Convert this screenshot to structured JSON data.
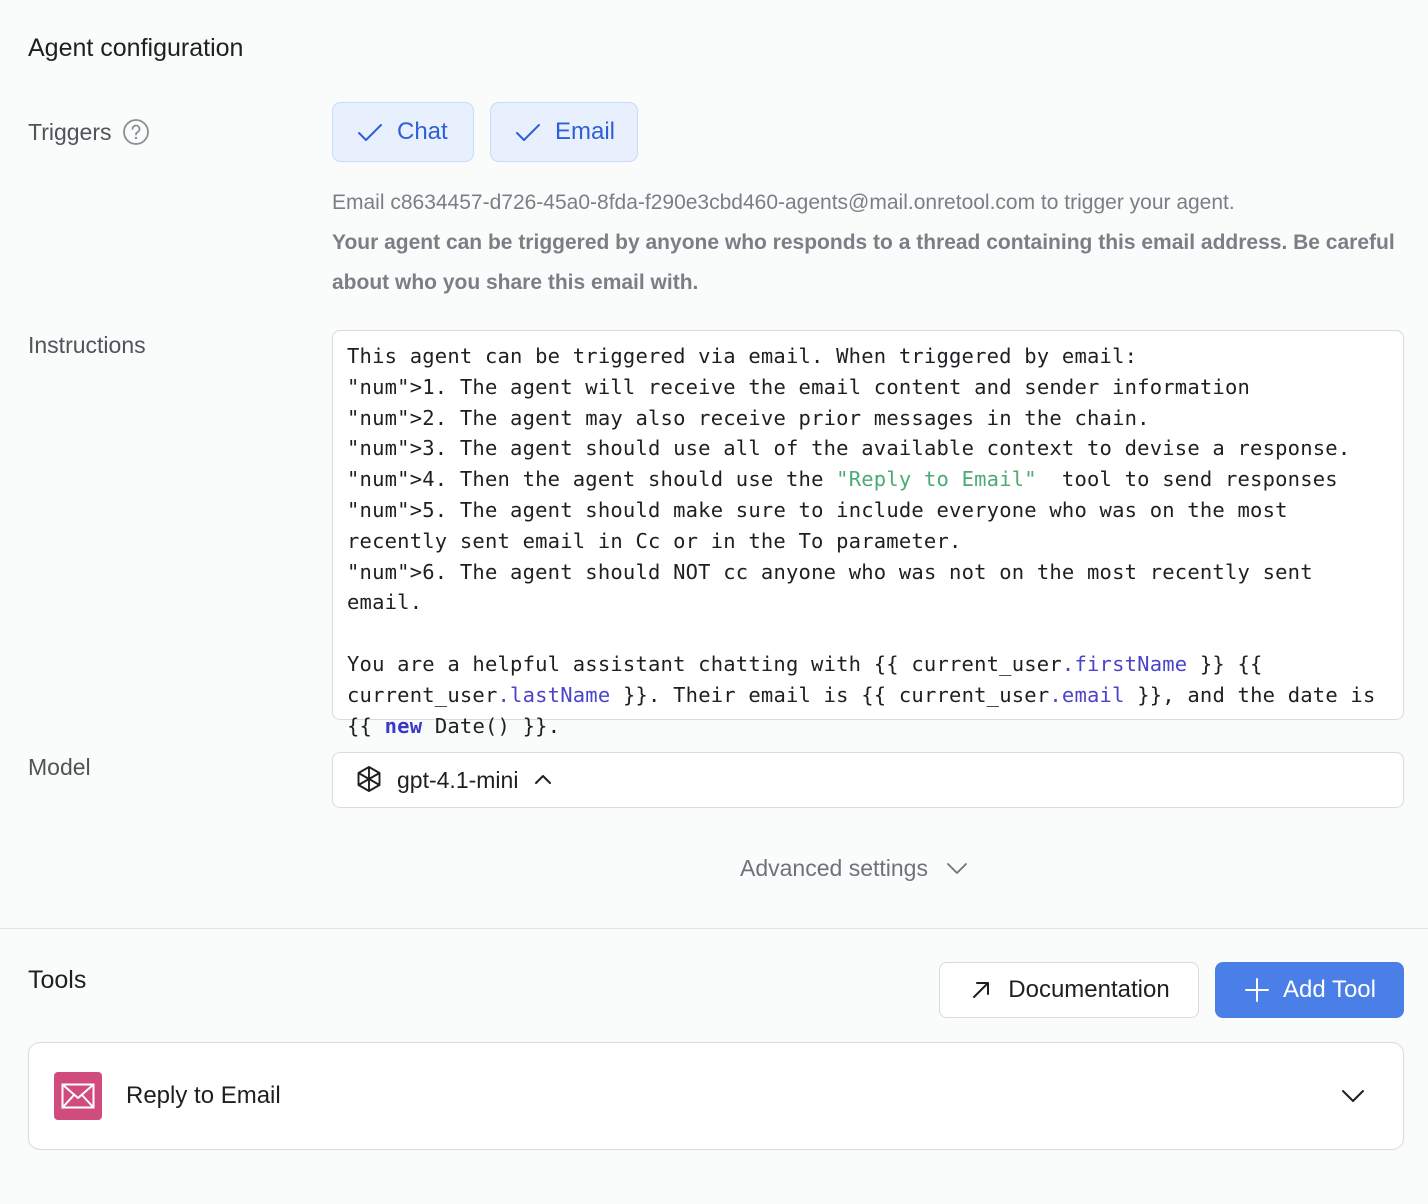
{
  "page": {
    "title": "Agent configuration"
  },
  "triggers": {
    "label": "Triggers",
    "options": [
      {
        "label": "Chat",
        "checked": true
      },
      {
        "label": "Email",
        "checked": true
      }
    ],
    "email_note": "Email c8634457-d726-45a0-8fda-f290e3cbd460-agents@mail.onretool.com to trigger your agent.",
    "email_warning": "Your agent can be triggered by anyone who responds to a thread containing this email address. Be careful about who you share this email with."
  },
  "instructions": {
    "label": "Instructions",
    "value": "This agent can be triggered via email. When triggered by email:\n1. The agent will receive the email content and sender information\n2. The agent may also receive prior messages in the chain.\n3. The agent should use all of the available context to devise a response.\n4. Then the agent should use the \"Reply to Email\"  tool to send responses\n5. The agent should make sure to include everyone who was on the most recently sent email in Cc or in the To parameter.\n6. The agent should NOT cc anyone who was not on the most recently sent email.\n\nYou are a helpful assistant chatting with {{ current_user.firstName }} {{ current_user.lastName }}. Their email is {{ current_user.email }}, and the date is {{ new Date() }}."
  },
  "model": {
    "label": "Model",
    "selected": "gpt-4.1-mini",
    "icon": "openai-icon"
  },
  "advanced": {
    "label": "Advanced settings"
  },
  "tools": {
    "title": "Tools",
    "documentation_label": "Documentation",
    "add_label": "Add Tool",
    "items": [
      {
        "name": "Reply to Email",
        "icon": "mail-icon",
        "color": "#d04c7c"
      }
    ]
  },
  "colors": {
    "accent": "#4a7fe8",
    "trigger_bg": "#e8f0fd",
    "trigger_text": "#2e5fd6"
  }
}
